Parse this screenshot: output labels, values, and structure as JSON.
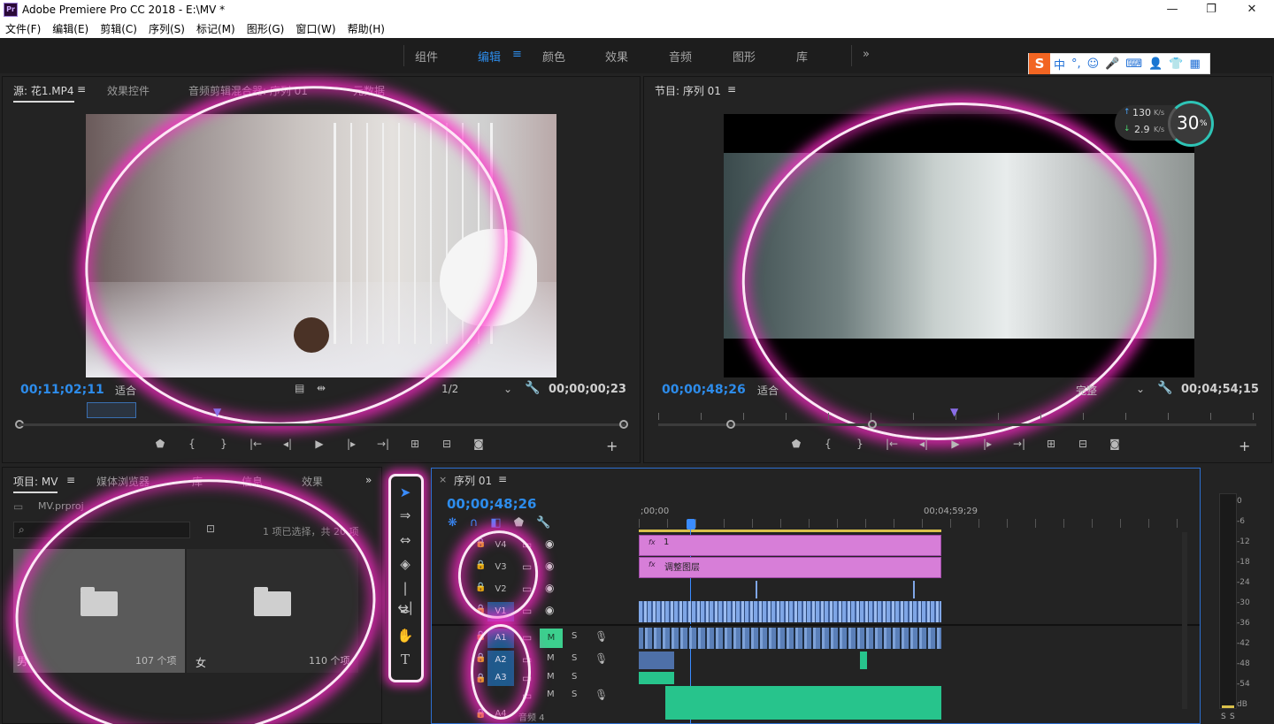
{
  "window": {
    "title": "Adobe Premiere Pro CC 2018 - E:\\MV *",
    "logo": "Pr"
  },
  "window_controls": {
    "minimize": "—",
    "restore": "❐",
    "close": "✕"
  },
  "menu": [
    "文件(F)",
    "编辑(E)",
    "剪辑(C)",
    "序列(S)",
    "标记(M)",
    "图形(G)",
    "窗口(W)",
    "帮助(H)"
  ],
  "workspaces": {
    "tabs": [
      "组件",
      "编辑",
      "颜色",
      "效果",
      "音频",
      "图形",
      "库"
    ],
    "active": "编辑",
    "active_menu": "≡",
    "overflow": "»"
  },
  "ime": {
    "logo": "S",
    "lang": "中",
    "punct": "°,",
    "icons": [
      "☺",
      "🎤",
      "⌨",
      "👤",
      "👕",
      "▦"
    ]
  },
  "net_widget": {
    "up": "130",
    "up_unit": "K/s",
    "down": "2.9",
    "down_unit": "K/s",
    "percent": "30",
    "percent_unit": "%"
  },
  "source_panel": {
    "tabs": [
      "源: 花1.MP4",
      "效果控件",
      "音频剪辑混合器: 序列 01",
      "元数据"
    ],
    "menu": "≡",
    "timecode": "00;11;02;11",
    "fit": "适合",
    "resolution": "1/2",
    "duration": "00;00;00;23"
  },
  "program_panel": {
    "title": "节目: 序列 01",
    "menu": "≡",
    "timecode": "00;00;48;26",
    "fit": "适合",
    "quality": "完整",
    "duration": "00;04;54;15"
  },
  "project_panel": {
    "tabs": [
      "项目: MV",
      "媒体浏览器",
      "库",
      "信息",
      "效果"
    ],
    "menu": "≡",
    "overflow": "»",
    "file": "MV.prproj",
    "selection": "1 项已选择，共 20 项",
    "bins": [
      {
        "name": "男",
        "count": "107 个项"
      },
      {
        "name": "女",
        "count": "110 个项"
      }
    ]
  },
  "timeline": {
    "sequence": "序列 01",
    "close": "×",
    "menu": "≡",
    "timecode": "00;00;48;26",
    "ruler_start": ";00;00",
    "ruler_mark": "00;04;59;29",
    "video_tracks": [
      "V4",
      "V3",
      "V2",
      "V1"
    ],
    "audio_tracks": [
      "A1",
      "A2",
      "A3",
      "A4"
    ],
    "audio_extra_label": "音频 4",
    "clips": {
      "v4": "1",
      "v3": "调整图层"
    },
    "mute": "M",
    "solo": "S"
  },
  "meter": {
    "labels": [
      "0",
      "-6",
      "-12",
      "-18",
      "-24",
      "-30",
      "-36",
      "-42",
      "-48",
      "-54",
      "dB"
    ],
    "solo": "S"
  },
  "colors": {
    "accent": "#2d8ceb",
    "adjust_clip": "#d77ed8",
    "video_clip": "#7fa6e6",
    "audio_clip": "#27c48c",
    "glow": "#ff28c8"
  }
}
